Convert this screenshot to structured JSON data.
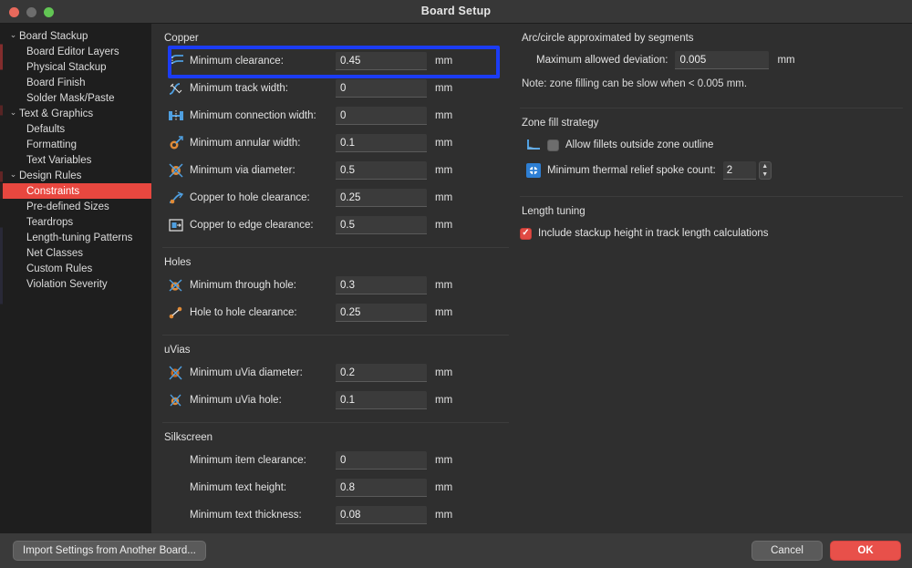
{
  "window": {
    "title": "Board Setup",
    "controls": [
      "close-button",
      "minimize-button",
      "zoom-button"
    ]
  },
  "sidebar": {
    "items": [
      {
        "label": "Board Stackup",
        "level": "group",
        "expanded": true,
        "selected": false
      },
      {
        "label": "Board Editor Layers",
        "level": "child",
        "selected": false
      },
      {
        "label": "Physical Stackup",
        "level": "child",
        "selected": false
      },
      {
        "label": "Board Finish",
        "level": "child",
        "selected": false
      },
      {
        "label": "Solder Mask/Paste",
        "level": "child",
        "selected": false
      },
      {
        "label": "Text & Graphics",
        "level": "group",
        "expanded": true,
        "selected": false
      },
      {
        "label": "Defaults",
        "level": "child",
        "selected": false
      },
      {
        "label": "Formatting",
        "level": "child",
        "selected": false
      },
      {
        "label": "Text Variables",
        "level": "child",
        "selected": false
      },
      {
        "label": "Design Rules",
        "level": "group",
        "expanded": true,
        "selected": false
      },
      {
        "label": "Constraints",
        "level": "child",
        "selected": true
      },
      {
        "label": "Pre-defined Sizes",
        "level": "child",
        "selected": false
      },
      {
        "label": "Teardrops",
        "level": "child",
        "selected": false
      },
      {
        "label": "Length-tuning Patterns",
        "level": "child",
        "selected": false
      },
      {
        "label": "Net Classes",
        "level": "child",
        "selected": false
      },
      {
        "label": "Custom Rules",
        "level": "child",
        "selected": false
      },
      {
        "label": "Violation Severity",
        "level": "child",
        "selected": false
      }
    ]
  },
  "copper": {
    "title": "Copper",
    "rows": [
      {
        "icon": "clearance-icon",
        "label": "Minimum clearance:",
        "value": "0.45",
        "unit": "mm",
        "highlighted": true
      },
      {
        "icon": "track-width-icon",
        "label": "Minimum track width:",
        "value": "0",
        "unit": "mm"
      },
      {
        "icon": "connection-width-icon",
        "label": "Minimum connection width:",
        "value": "0",
        "unit": "mm"
      },
      {
        "icon": "annular-width-icon",
        "label": "Minimum annular width:",
        "value": "0.1",
        "unit": "mm"
      },
      {
        "icon": "via-diameter-icon",
        "label": "Minimum via diameter:",
        "value": "0.5",
        "unit": "mm"
      },
      {
        "icon": "copper-to-hole-icon",
        "label": "Copper to hole clearance:",
        "value": "0.25",
        "unit": "mm"
      },
      {
        "icon": "copper-to-edge-icon",
        "label": "Copper to edge clearance:",
        "value": "0.5",
        "unit": "mm"
      }
    ]
  },
  "holes": {
    "title": "Holes",
    "rows": [
      {
        "icon": "through-hole-icon",
        "label": "Minimum through hole:",
        "value": "0.3",
        "unit": "mm"
      },
      {
        "icon": "hole-to-hole-icon",
        "label": "Hole to hole clearance:",
        "value": "0.25",
        "unit": "mm"
      }
    ]
  },
  "uvias": {
    "title": "uVias",
    "rows": [
      {
        "icon": "uvia-diameter-icon",
        "label": "Minimum uVia diameter:",
        "value": "0.2",
        "unit": "mm"
      },
      {
        "icon": "uvia-hole-icon",
        "label": "Minimum uVia hole:",
        "value": "0.1",
        "unit": "mm"
      }
    ]
  },
  "silkscreen": {
    "title": "Silkscreen",
    "rows": [
      {
        "icon": "",
        "label": "Minimum item clearance:",
        "value": "0",
        "unit": "mm"
      },
      {
        "icon": "",
        "label": "Minimum text height:",
        "value": "0.8",
        "unit": "mm"
      },
      {
        "icon": "",
        "label": "Minimum text thickness:",
        "value": "0.08",
        "unit": "mm"
      }
    ]
  },
  "arc_circle": {
    "title": "Arc/circle approximated by segments",
    "deviation_label": "Maximum allowed deviation:",
    "deviation_value": "0.005",
    "deviation_unit": "mm",
    "note": "Note: zone filling can be slow when < 0.005 mm."
  },
  "zone_fill": {
    "title": "Zone fill strategy",
    "allow_fillets_label": "Allow fillets outside zone outline",
    "allow_fillets_checked": false,
    "spoke_count_label": "Minimum thermal relief spoke count:",
    "spoke_count_value": "2"
  },
  "length_tuning": {
    "title": "Length tuning",
    "include_stackup_label": "Include stackup height in track length calculations",
    "include_stackup_checked": true
  },
  "footer": {
    "import_label": "Import Settings from Another Board...",
    "cancel_label": "Cancel",
    "ok_label": "OK"
  },
  "colors": {
    "selection_red": "#e8473f",
    "ok_red": "#e8504a",
    "highlight_blue": "#1b3cf5",
    "window_bg": "#2f2f2f",
    "sidebar_bg": "#1e1e1e"
  }
}
